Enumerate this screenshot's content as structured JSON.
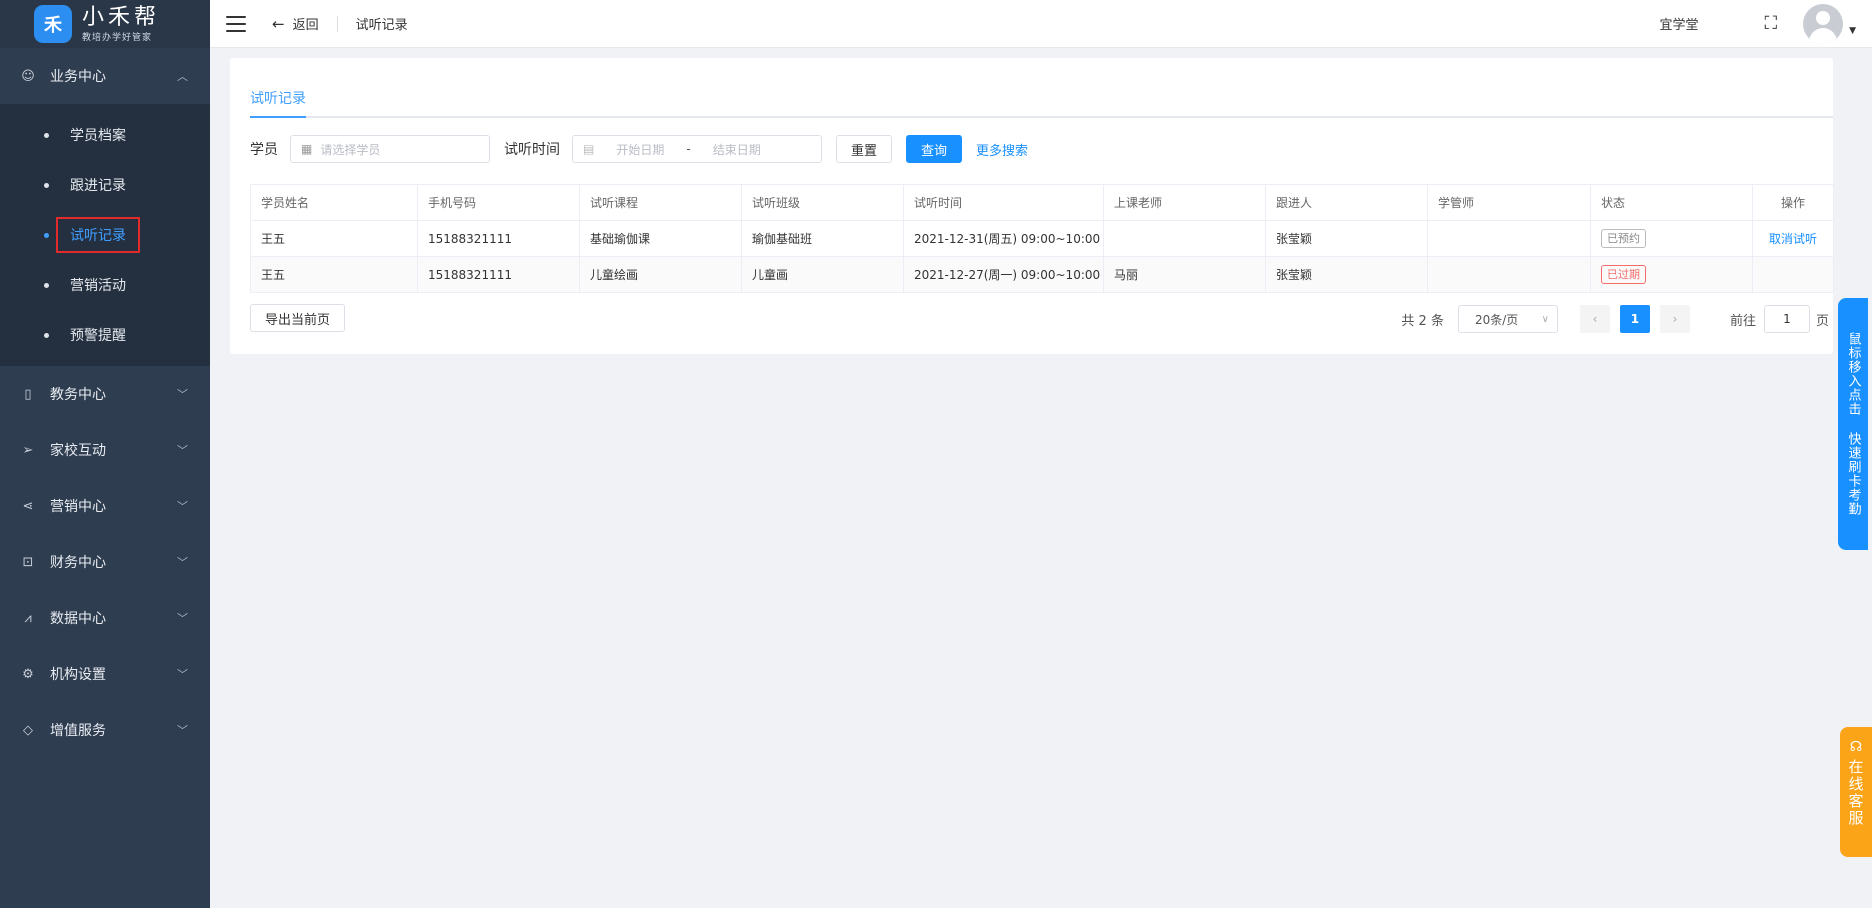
{
  "logo": {
    "badge": "禾",
    "title": "小禾帮",
    "subtitle": "教培办学好管家"
  },
  "sidebar": {
    "groups": [
      {
        "label": "业务中心",
        "icon": "user-circle-icon",
        "expanded": true,
        "items": [
          {
            "label": "学员档案"
          },
          {
            "label": "跟进记录"
          },
          {
            "label": "试听记录",
            "active": true
          },
          {
            "label": "营销活动"
          },
          {
            "label": "预警提醒"
          }
        ]
      },
      {
        "label": "教务中心",
        "icon": "book-icon"
      },
      {
        "label": "家校互动",
        "icon": "paper-plane-icon"
      },
      {
        "label": "营销中心",
        "icon": "share-icon"
      },
      {
        "label": "财务中心",
        "icon": "finance-icon"
      },
      {
        "label": "数据中心",
        "icon": "chart-icon"
      },
      {
        "label": "机构设置",
        "icon": "gear-icon"
      },
      {
        "label": "增值服务",
        "icon": "diamond-icon"
      }
    ]
  },
  "header": {
    "back_label": "返回",
    "crumb": "试听记录",
    "org": "宜学堂"
  },
  "tabs": [
    {
      "label": "试听记录"
    }
  ],
  "filter": {
    "student_label": "学员",
    "student_placeholder": "请选择学员",
    "time_label": "试听时间",
    "start_placeholder": "开始日期",
    "sep": "-",
    "end_placeholder": "结束日期",
    "reset_label": "重置",
    "query_label": "查询",
    "more_label": "更多搜索"
  },
  "table": {
    "columns": [
      "学员姓名",
      "手机号码",
      "试听课程",
      "试听班级",
      "试听时间",
      "上课老师",
      "跟进人",
      "学管师",
      "状态",
      "操作"
    ],
    "rows": [
      {
        "name": "王五",
        "phone": "15188321111",
        "course": "基础瑜伽课",
        "class": "瑜伽基础班",
        "time": "2021-12-31(周五) 09:00~10:00",
        "teacher": "",
        "follower": "张莹颖",
        "manager": "",
        "status": "已预约",
        "action": "取消试听"
      },
      {
        "name": "王五",
        "phone": "15188321111",
        "course": "儿童绘画",
        "class": "儿童画",
        "time": "2021-12-27(周一) 09:00~10:00",
        "teacher": "马丽",
        "follower": "张莹颖",
        "manager": "",
        "status": "已过期",
        "action": ""
      }
    ]
  },
  "footer": {
    "export_label": "导出当前页",
    "total": "共 2 条",
    "page_size": "20条/页",
    "current_page": "1",
    "goto_label": "前往",
    "goto_value": "1",
    "page_unit": "页"
  },
  "float": {
    "blue_text": "鼠标移入点击 快速刷卡考勤",
    "orange_text": "在线客服"
  },
  "colors": {
    "primary": "#1890ff",
    "sidebar": "#2f3d51",
    "danger": "#f56c6c",
    "orange": "#fba418"
  }
}
